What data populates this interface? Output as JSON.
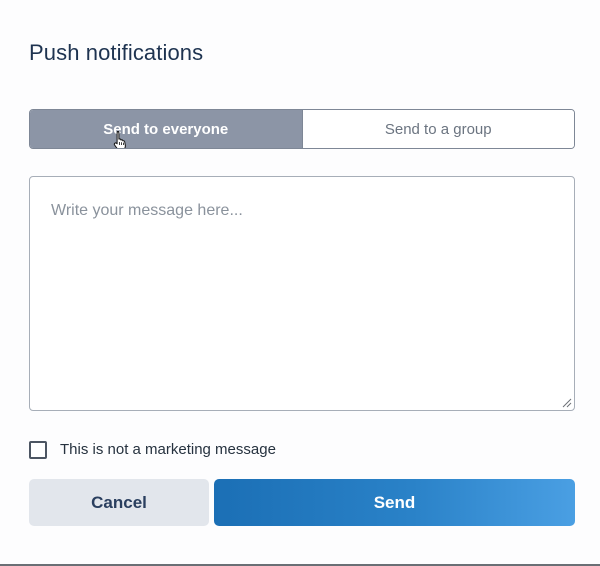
{
  "dialog": {
    "title": "Push notifications"
  },
  "audience_toggle": {
    "options": [
      {
        "label": "Send to everyone",
        "selected": true
      },
      {
        "label": "Send to a group",
        "selected": false
      }
    ]
  },
  "message": {
    "value": "",
    "placeholder": "Write your message here..."
  },
  "marketing_checkbox": {
    "label": "This is not a marketing message",
    "checked": false
  },
  "actions": {
    "cancel_label": "Cancel",
    "send_label": "Send"
  },
  "colors": {
    "primary": "#1b6fb5",
    "toggle_active": "#8c95a6",
    "title": "#1e3350"
  },
  "icons": {
    "pointer": "hand-pointer-icon",
    "resize": "resize-grip-icon"
  }
}
